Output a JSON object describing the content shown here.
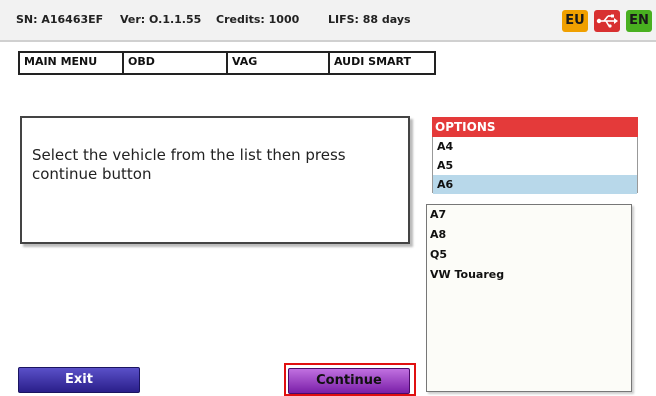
{
  "status": {
    "sn": "SN: A16463EF",
    "ver": "Ver: O.1.1.55",
    "credits": "Credits: 1000",
    "lifs": "LIFS: 88 days",
    "badges": [
      {
        "label": "EU",
        "color": "#f0a000"
      },
      {
        "label": "",
        "icon": "usb-icon",
        "color": "#d83030"
      },
      {
        "label": "EN",
        "color": "#49b020"
      }
    ]
  },
  "breadcrumb": [
    "MAIN MENU",
    "OBD",
    "VAG",
    "AUDI SMART"
  ],
  "message": "Select the vehicle from the list then press continue button",
  "options": {
    "header": "OPTIONS",
    "items": [
      "A4",
      "A5",
      "A6",
      "A7",
      "A8",
      "Q5",
      "VW Touareg"
    ],
    "selected": "A6"
  },
  "buttons": {
    "exit": "Exit",
    "continue": "Continue"
  }
}
